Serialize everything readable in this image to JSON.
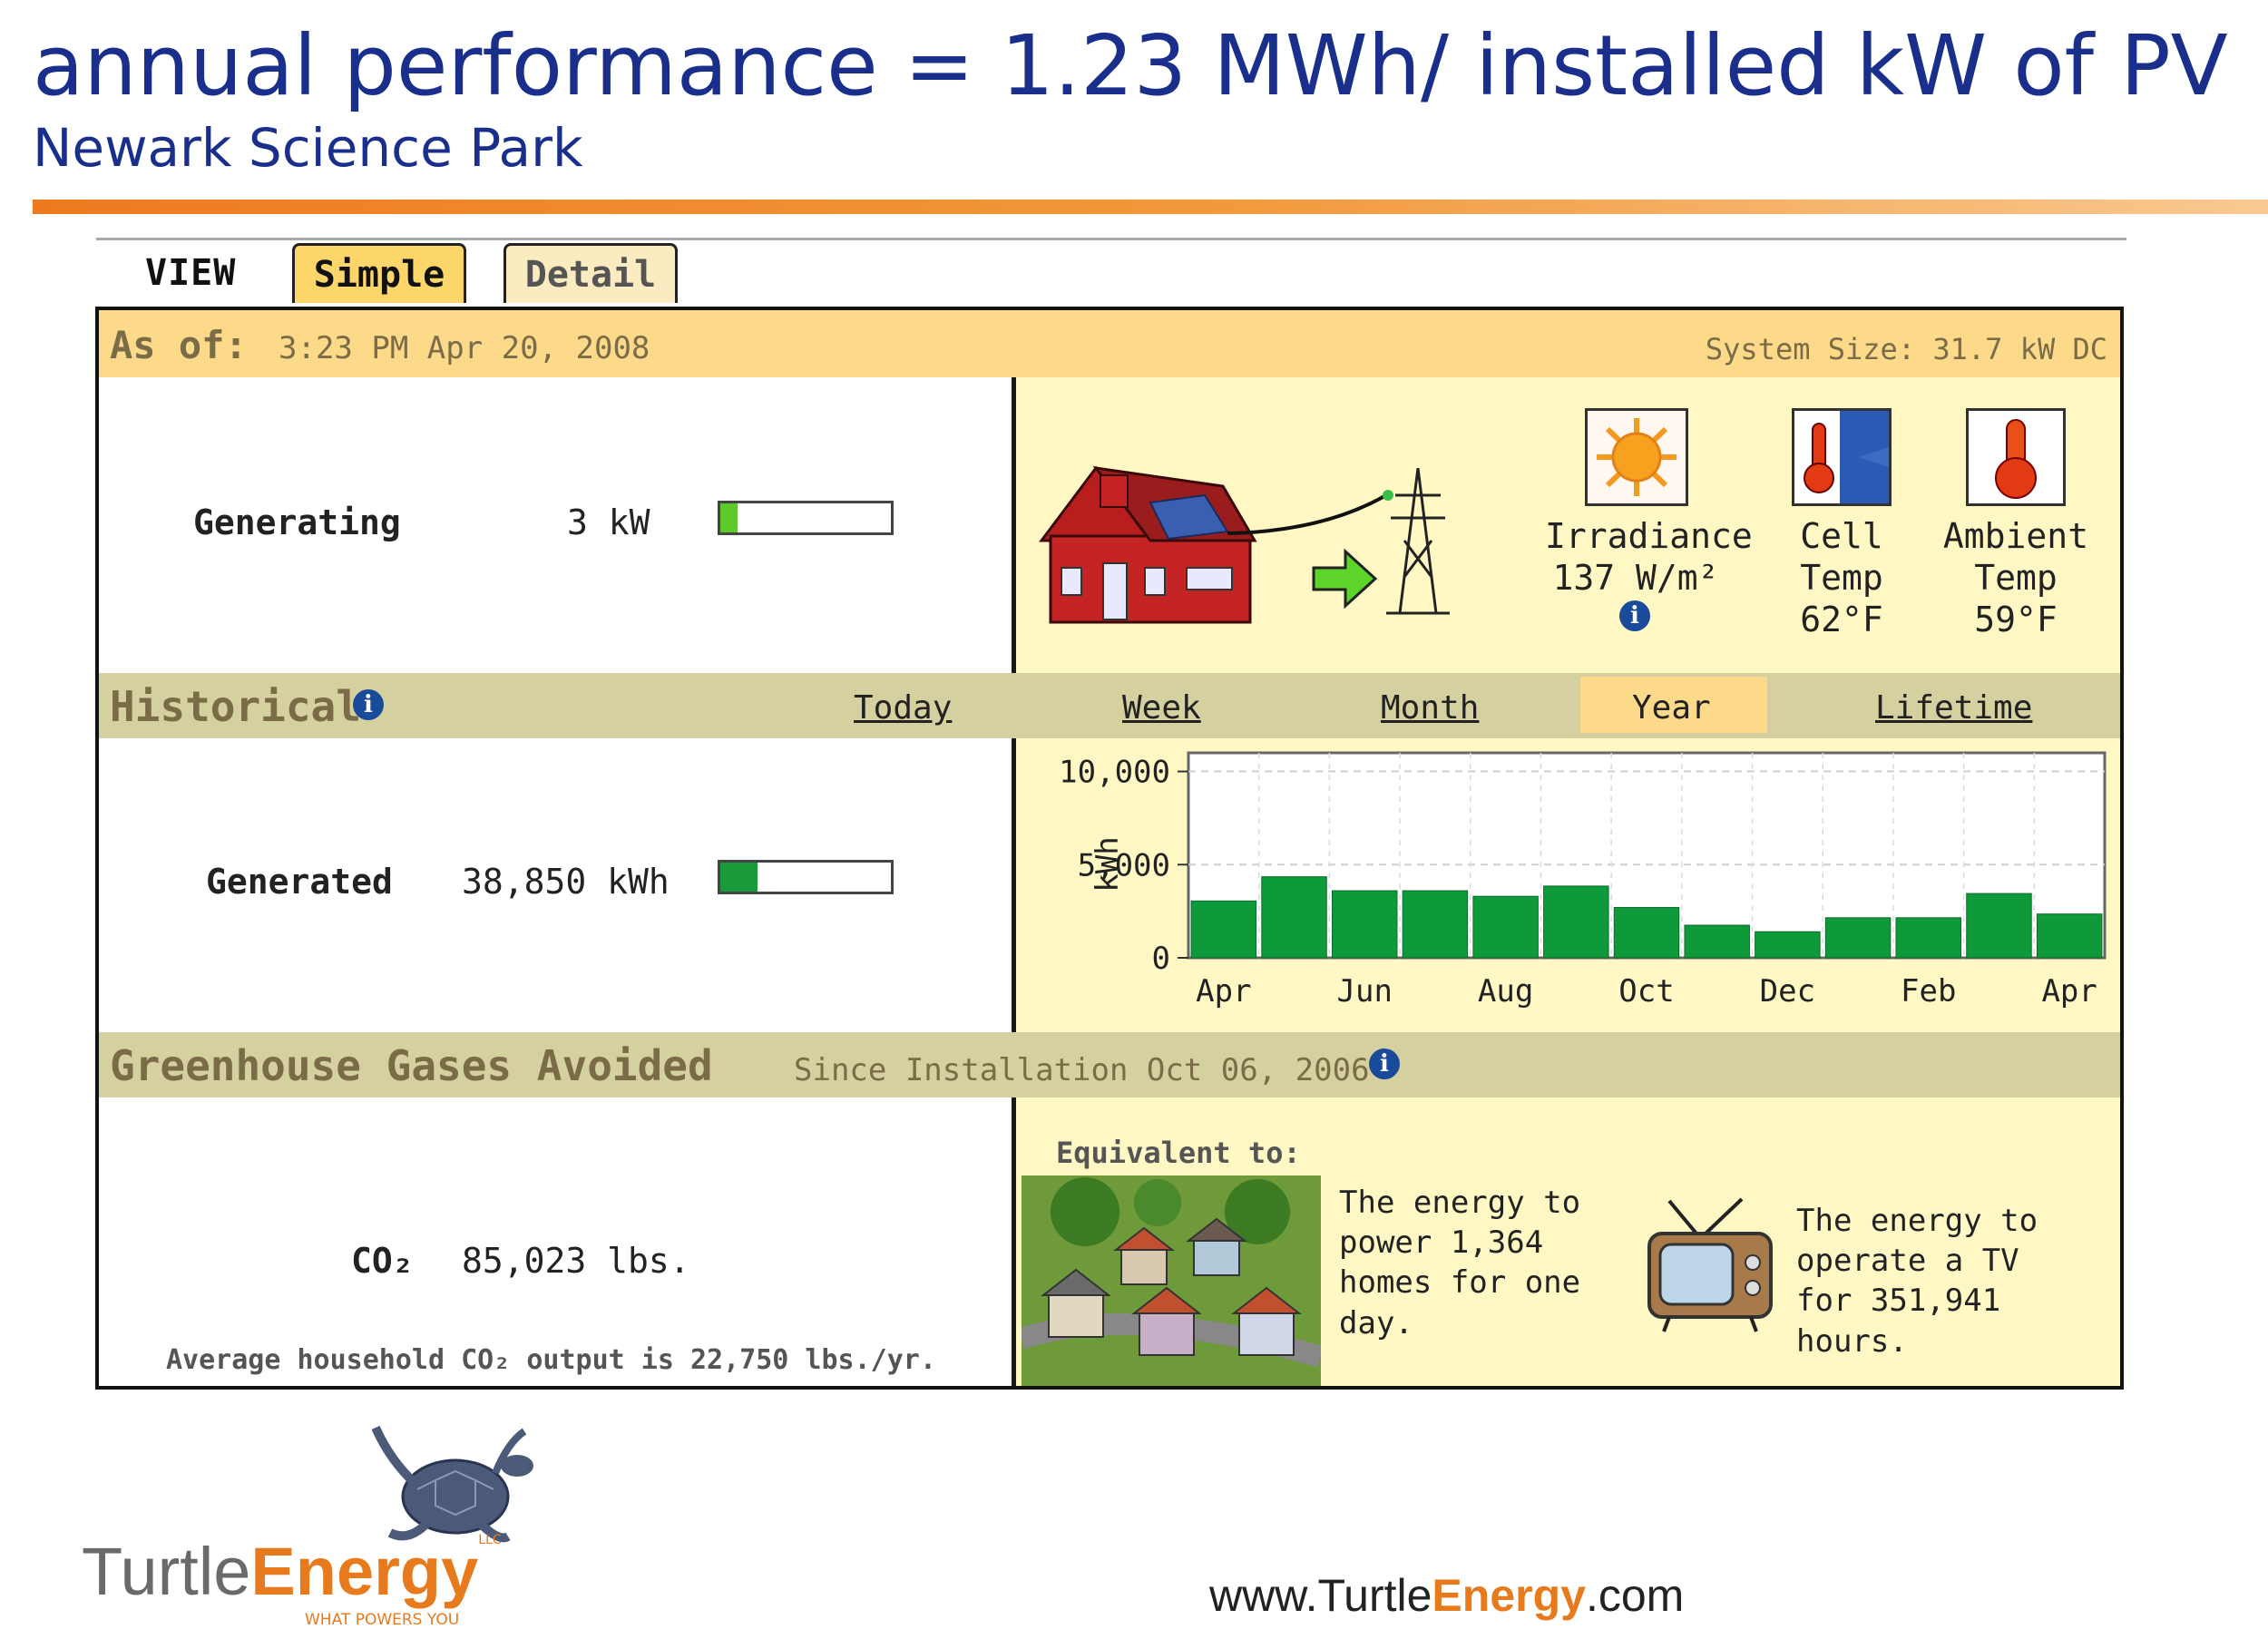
{
  "slide": {
    "title": "annual performance = 1.23 MWh/ installed kW of PV",
    "subtitle": "Newark Science Park"
  },
  "tabs": {
    "view_label": "VIEW",
    "simple": "Simple",
    "detail": "Detail",
    "active": "Simple"
  },
  "status": {
    "as_of_label": "As of:",
    "as_of_value": "3:23 PM Apr 20, 2008",
    "system_size": "System Size: 31.7 kW DC"
  },
  "generating": {
    "label": "Generating",
    "value": "3 kW",
    "level": 0.1
  },
  "sensors": {
    "irradiance_label": "Irradiance",
    "irradiance_value": "137 W/m²",
    "cell_label_1": "Cell",
    "cell_label_2": "Temp",
    "cell_value": "62°F",
    "ambient_label_1": "Ambient",
    "ambient_label_2": "Temp",
    "ambient_value": "59°F"
  },
  "historical": {
    "title": "Historical",
    "links": [
      "Today",
      "Week",
      "Month",
      "Year",
      "Lifetime"
    ],
    "selected": "Year",
    "generated_label": "Generated",
    "generated_value": "38,850 kWh",
    "generated_level": 0.22
  },
  "chart_data": {
    "type": "bar",
    "ylabel": "kWh",
    "ylim": [
      0,
      11000
    ],
    "yticks": [
      "10,000",
      "5,000",
      "0"
    ],
    "ytick_values": [
      10000,
      5000,
      0
    ],
    "xtick_labels": [
      "Apr",
      "Jun",
      "Aug",
      "Oct",
      "Dec",
      "Feb",
      "Apr"
    ],
    "values": [
      3050,
      4350,
      3600,
      3600,
      3300,
      3850,
      2700,
      1750,
      1400,
      2150,
      2150,
      3450,
      2350
    ],
    "bar_color": "#0e9a3a",
    "grid": true
  },
  "ghg": {
    "title": "Greenhouse Gases Avoided",
    "since": "Since Installation Oct 06, 2006",
    "co2_label": "CO₂",
    "co2_value": "85,023 lbs.",
    "average_note": "Average household CO₂ output is 22,750 lbs./yr.",
    "equivalent_label": "Equivalent to:",
    "homes_text": "The energy to power 1,364 homes for one day.",
    "tv_text": "The energy to operate a TV for 351,941 hours."
  },
  "footer": {
    "url_prefix": "www.Turtle",
    "url_brand": "Energy",
    "url_suffix": ".com",
    "logo_turtle": "Turtle",
    "logo_energy": "Energy",
    "logo_llc": "LLC",
    "logo_tagline": "WHAT POWERS YOU"
  },
  "colors": {
    "title_blue": "#1a2f8c",
    "accent_orange": "#ef7a1e",
    "panel_yellow": "#fff8c4",
    "band_tan": "#d4d0a0",
    "bar_green": "#0e9a3a"
  }
}
